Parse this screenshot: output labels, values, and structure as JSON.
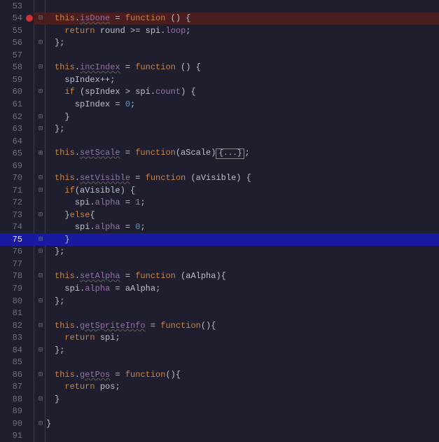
{
  "lines": [
    {
      "n": 53,
      "bp": false,
      "fold": "",
      "hl": "",
      "tokens": []
    },
    {
      "n": 54,
      "bp": true,
      "fold": "⊟",
      "hl": "bp",
      "tokens": [
        {
          "c": "tok-this",
          "t": "this"
        },
        {
          "c": "tok-punc",
          "t": "."
        },
        {
          "c": "tok-propwav",
          "t": "isDone"
        },
        {
          "c": "tok-op",
          "t": " = "
        },
        {
          "c": "tok-fun",
          "t": "function"
        },
        {
          "c": "tok-punc",
          "t": " () {"
        }
      ]
    },
    {
      "n": 55,
      "bp": false,
      "fold": "",
      "hl": "",
      "tokens": [
        {
          "c": "tok-punc",
          "t": "  "
        },
        {
          "c": "tok-kw",
          "t": "return"
        },
        {
          "c": "tok-ident",
          "t": " round "
        },
        {
          "c": "tok-op",
          "t": ">="
        },
        {
          "c": "tok-ident",
          "t": " spi"
        },
        {
          "c": "tok-punc",
          "t": "."
        },
        {
          "c": "tok-prop",
          "t": "loop"
        },
        {
          "c": "tok-punc",
          "t": ";"
        }
      ]
    },
    {
      "n": 56,
      "bp": false,
      "fold": "⊟",
      "hl": "",
      "tokens": [
        {
          "c": "tok-punc",
          "t": "};"
        }
      ]
    },
    {
      "n": 57,
      "bp": false,
      "fold": "",
      "hl": "",
      "tokens": []
    },
    {
      "n": 58,
      "bp": false,
      "fold": "⊟",
      "hl": "",
      "tokens": [
        {
          "c": "tok-this",
          "t": "this"
        },
        {
          "c": "tok-punc",
          "t": "."
        },
        {
          "c": "tok-propwav",
          "t": "incIndex"
        },
        {
          "c": "tok-op",
          "t": " = "
        },
        {
          "c": "tok-fun",
          "t": "function"
        },
        {
          "c": "tok-punc",
          "t": " () {"
        }
      ]
    },
    {
      "n": 59,
      "bp": false,
      "fold": "",
      "hl": "",
      "tokens": [
        {
          "c": "tok-punc",
          "t": "  "
        },
        {
          "c": "tok-ident",
          "t": "spIndex"
        },
        {
          "c": "tok-op",
          "t": "++"
        },
        {
          "c": "tok-punc",
          "t": ";"
        }
      ]
    },
    {
      "n": 60,
      "bp": false,
      "fold": "⊟",
      "hl": "",
      "tokens": [
        {
          "c": "tok-punc",
          "t": "  "
        },
        {
          "c": "tok-kw",
          "t": "if"
        },
        {
          "c": "tok-punc",
          "t": " ("
        },
        {
          "c": "tok-ident",
          "t": "spIndex "
        },
        {
          "c": "tok-op",
          "t": ">"
        },
        {
          "c": "tok-ident",
          "t": " spi"
        },
        {
          "c": "tok-punc",
          "t": "."
        },
        {
          "c": "tok-prop",
          "t": "count"
        },
        {
          "c": "tok-punc",
          "t": ") {"
        }
      ]
    },
    {
      "n": 61,
      "bp": false,
      "fold": "",
      "hl": "",
      "tokens": [
        {
          "c": "tok-punc",
          "t": "    "
        },
        {
          "c": "tok-ident",
          "t": "spIndex "
        },
        {
          "c": "tok-op",
          "t": "="
        },
        {
          "c": "tok-punc",
          "t": " "
        },
        {
          "c": "tok-num",
          "t": "0"
        },
        {
          "c": "tok-punc",
          "t": ";"
        }
      ]
    },
    {
      "n": 62,
      "bp": false,
      "fold": "⊟",
      "hl": "",
      "tokens": [
        {
          "c": "tok-punc",
          "t": "  }"
        }
      ]
    },
    {
      "n": 63,
      "bp": false,
      "fold": "⊟",
      "hl": "",
      "tokens": [
        {
          "c": "tok-punc",
          "t": "};"
        }
      ]
    },
    {
      "n": 64,
      "bp": false,
      "fold": "",
      "hl": "",
      "tokens": []
    },
    {
      "n": 65,
      "bp": false,
      "fold": "⊞",
      "hl": "",
      "tokens": [
        {
          "c": "tok-this",
          "t": "this"
        },
        {
          "c": "tok-punc",
          "t": "."
        },
        {
          "c": "tok-propwav",
          "t": "setScale"
        },
        {
          "c": "tok-op",
          "t": " = "
        },
        {
          "c": "tok-fun",
          "t": "function"
        },
        {
          "c": "tok-punc",
          "t": "("
        },
        {
          "c": "tok-param",
          "t": "aScale"
        },
        {
          "c": "tok-punc",
          "t": ")"
        },
        {
          "c": "fold-box",
          "t": "{...}"
        },
        {
          "c": "tok-punc",
          "t": ";"
        }
      ]
    },
    {
      "n": 69,
      "bp": false,
      "fold": "",
      "hl": "",
      "tokens": []
    },
    {
      "n": 70,
      "bp": false,
      "fold": "⊟",
      "hl": "",
      "tokens": [
        {
          "c": "tok-this",
          "t": "this"
        },
        {
          "c": "tok-punc",
          "t": "."
        },
        {
          "c": "tok-propwav",
          "t": "setVisible"
        },
        {
          "c": "tok-op",
          "t": " = "
        },
        {
          "c": "tok-fun",
          "t": "function"
        },
        {
          "c": "tok-punc",
          "t": " ("
        },
        {
          "c": "tok-param",
          "t": "aVisible"
        },
        {
          "c": "tok-punc",
          "t": ") {"
        }
      ]
    },
    {
      "n": 71,
      "bp": false,
      "fold": "⊟",
      "hl": "",
      "tokens": [
        {
          "c": "tok-punc",
          "t": "  "
        },
        {
          "c": "tok-kw",
          "t": "if"
        },
        {
          "c": "tok-punc",
          "t": "("
        },
        {
          "c": "tok-ident",
          "t": "aVisible"
        },
        {
          "c": "tok-punc",
          "t": ") {"
        }
      ]
    },
    {
      "n": 72,
      "bp": false,
      "fold": "",
      "hl": "",
      "tokens": [
        {
          "c": "tok-punc",
          "t": "    "
        },
        {
          "c": "tok-ident",
          "t": "spi"
        },
        {
          "c": "tok-punc",
          "t": "."
        },
        {
          "c": "tok-prop",
          "t": "alpha"
        },
        {
          "c": "tok-op",
          "t": " = "
        },
        {
          "c": "tok-num",
          "t": "1"
        },
        {
          "c": "tok-punc",
          "t": ";"
        }
      ]
    },
    {
      "n": 73,
      "bp": false,
      "fold": "⊟",
      "hl": "",
      "tokens": [
        {
          "c": "tok-punc",
          "t": "  }"
        },
        {
          "c": "tok-kw",
          "t": "else"
        },
        {
          "c": "tok-punc",
          "t": "{"
        }
      ]
    },
    {
      "n": 74,
      "bp": false,
      "fold": "",
      "hl": "",
      "tokens": [
        {
          "c": "tok-punc",
          "t": "    "
        },
        {
          "c": "tok-ident",
          "t": "spi"
        },
        {
          "c": "tok-punc",
          "t": "."
        },
        {
          "c": "tok-prop",
          "t": "alpha"
        },
        {
          "c": "tok-op",
          "t": " = "
        },
        {
          "c": "tok-num",
          "t": "0"
        },
        {
          "c": "tok-punc",
          "t": ";"
        }
      ]
    },
    {
      "n": 75,
      "bp": false,
      "fold": "⊟",
      "hl": "cur",
      "tokens": [
        {
          "c": "tok-punc",
          "t": "  }"
        }
      ]
    },
    {
      "n": 76,
      "bp": false,
      "fold": "⊟",
      "hl": "",
      "tokens": [
        {
          "c": "tok-punc",
          "t": "};"
        }
      ]
    },
    {
      "n": 77,
      "bp": false,
      "fold": "",
      "hl": "",
      "tokens": []
    },
    {
      "n": 78,
      "bp": false,
      "fold": "⊟",
      "hl": "",
      "tokens": [
        {
          "c": "tok-this",
          "t": "this"
        },
        {
          "c": "tok-punc",
          "t": "."
        },
        {
          "c": "tok-propwav",
          "t": "setAlpha"
        },
        {
          "c": "tok-op",
          "t": " = "
        },
        {
          "c": "tok-fun",
          "t": "function"
        },
        {
          "c": "tok-punc",
          "t": " ("
        },
        {
          "c": "tok-param",
          "t": "aAlpha"
        },
        {
          "c": "tok-punc",
          "t": "){"
        }
      ]
    },
    {
      "n": 79,
      "bp": false,
      "fold": "",
      "hl": "",
      "tokens": [
        {
          "c": "tok-punc",
          "t": "  "
        },
        {
          "c": "tok-ident",
          "t": "spi"
        },
        {
          "c": "tok-punc",
          "t": "."
        },
        {
          "c": "tok-prop",
          "t": "alpha"
        },
        {
          "c": "tok-op",
          "t": " = "
        },
        {
          "c": "tok-ident",
          "t": "aAlpha"
        },
        {
          "c": "tok-punc",
          "t": ";"
        }
      ]
    },
    {
      "n": 80,
      "bp": false,
      "fold": "⊟",
      "hl": "",
      "tokens": [
        {
          "c": "tok-punc",
          "t": "};"
        }
      ]
    },
    {
      "n": 81,
      "bp": false,
      "fold": "",
      "hl": "",
      "tokens": []
    },
    {
      "n": 82,
      "bp": false,
      "fold": "⊟",
      "hl": "",
      "tokens": [
        {
          "c": "tok-this",
          "t": "this"
        },
        {
          "c": "tok-punc",
          "t": "."
        },
        {
          "c": "tok-propwav",
          "t": "getSpriteInfo"
        },
        {
          "c": "tok-op",
          "t": " = "
        },
        {
          "c": "tok-fun",
          "t": "function"
        },
        {
          "c": "tok-punc",
          "t": "(){"
        }
      ]
    },
    {
      "n": 83,
      "bp": false,
      "fold": "",
      "hl": "",
      "tokens": [
        {
          "c": "tok-punc",
          "t": "  "
        },
        {
          "c": "tok-kw",
          "t": "return"
        },
        {
          "c": "tok-ident",
          "t": " spi"
        },
        {
          "c": "tok-punc",
          "t": ";"
        }
      ]
    },
    {
      "n": 84,
      "bp": false,
      "fold": "⊟",
      "hl": "",
      "tokens": [
        {
          "c": "tok-punc",
          "t": "};"
        }
      ]
    },
    {
      "n": 85,
      "bp": false,
      "fold": "",
      "hl": "",
      "tokens": []
    },
    {
      "n": 86,
      "bp": false,
      "fold": "⊟",
      "hl": "",
      "tokens": [
        {
          "c": "tok-this",
          "t": "this"
        },
        {
          "c": "tok-punc",
          "t": "."
        },
        {
          "c": "tok-propwav",
          "t": "getPos"
        },
        {
          "c": "tok-op",
          "t": " = "
        },
        {
          "c": "tok-fun",
          "t": "function"
        },
        {
          "c": "tok-punc",
          "t": "(){"
        }
      ]
    },
    {
      "n": 87,
      "bp": false,
      "fold": "",
      "hl": "",
      "tokens": [
        {
          "c": "tok-punc",
          "t": "  "
        },
        {
          "c": "tok-kw",
          "t": "return"
        },
        {
          "c": "tok-ident",
          "t": " pos"
        },
        {
          "c": "tok-punc",
          "t": ";"
        }
      ]
    },
    {
      "n": 88,
      "bp": false,
      "fold": "⊟",
      "hl": "",
      "tokens": [
        {
          "c": "tok-punc",
          "t": "}"
        }
      ]
    },
    {
      "n": 89,
      "bp": false,
      "fold": "",
      "hl": "",
      "tokens": []
    },
    {
      "n": 90,
      "bp": false,
      "fold": "⊟",
      "hl": "",
      "tokens": [
        {
          "c": "tok-punc",
          "t": "}"
        }
      ],
      "outdent": true
    },
    {
      "n": 91,
      "bp": false,
      "fold": "",
      "hl": "",
      "tokens": []
    }
  ]
}
